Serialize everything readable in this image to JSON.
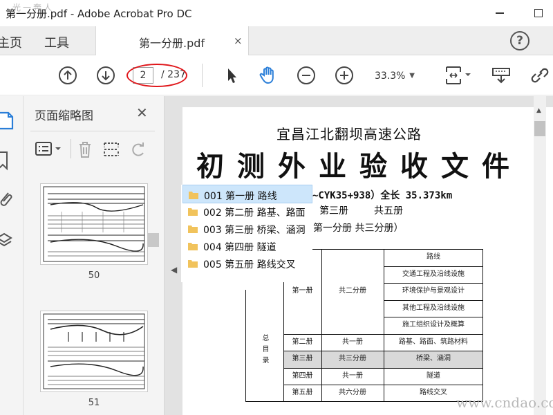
{
  "window": {
    "title": "第一分册.pdf - Adobe Acrobat Pro DC",
    "watermark_small": "光一奔人"
  },
  "tabbar": {
    "home_label": "主页",
    "tools_label": "工具",
    "document_tab": "第一分册.pdf",
    "tab_close": "×",
    "help": "?"
  },
  "toolbar": {
    "current_page": "2",
    "total_pages": "/ 237",
    "zoom": "33.3%"
  },
  "panel": {
    "title": "页面缩略图",
    "close": "✕",
    "thumbnails": [
      {
        "label": "50"
      },
      {
        "label": "51"
      }
    ]
  },
  "document": {
    "heading1": "宜昌江北翻坝高速公路",
    "heading2": "初测外业验收文件",
    "line_range": "~CYK35+938）全长 35.373km",
    "line_volume_a": "第三册",
    "line_volume_b": "共五册",
    "line_sub": "第一分册  共三分册）",
    "table": {
      "side_label": "总目录",
      "rows": [
        {
          "vol": "第一册",
          "split": "共二分册",
          "content": [
            "路线",
            "交通工程及沿线设施",
            "环境保护与景观设计",
            "其他工程及沿线设施",
            "施工组织设计及概算"
          ]
        },
        {
          "vol": "第二册",
          "split": "共一册",
          "content": [
            "路基、路面、筑路材料"
          ]
        },
        {
          "vol": "第三册",
          "split": "共三分册",
          "content": [
            "桥梁、涵洞"
          ],
          "highlight": true
        },
        {
          "vol": "第四册",
          "split": "共一册",
          "content": [
            "隧道"
          ]
        },
        {
          "vol": "第五册",
          "split": "共六分册",
          "content": [
            "路线交叉"
          ]
        }
      ]
    }
  },
  "bookmarks": [
    {
      "label": "001 第一册 路线",
      "selected": true
    },
    {
      "label": "002 第二册 路基、路面",
      "selected": false
    },
    {
      "label": "003 第三册 桥梁、涵洞",
      "selected": false
    },
    {
      "label": "004 第四册 隧道",
      "selected": false
    },
    {
      "label": "005 第五册 路线交叉",
      "selected": false
    }
  ],
  "watermark": "www.cndao.com",
  "colors": {
    "annotation_red": "#e0161a",
    "selection_blue": "#cde6fb",
    "hand_tool_blue": "#2a7ed8",
    "folder_yellow": "#f1c35c"
  },
  "icons": {
    "prev_page": "arrow-up-circle-icon",
    "next_page": "arrow-down-circle-icon",
    "select": "cursor-arrow-icon",
    "hand": "hand-icon",
    "zoom_out": "minus-circle-icon",
    "zoom_in": "plus-circle-icon",
    "fit": "fit-page-icon",
    "print": "print-icon",
    "link": "link-icon"
  }
}
